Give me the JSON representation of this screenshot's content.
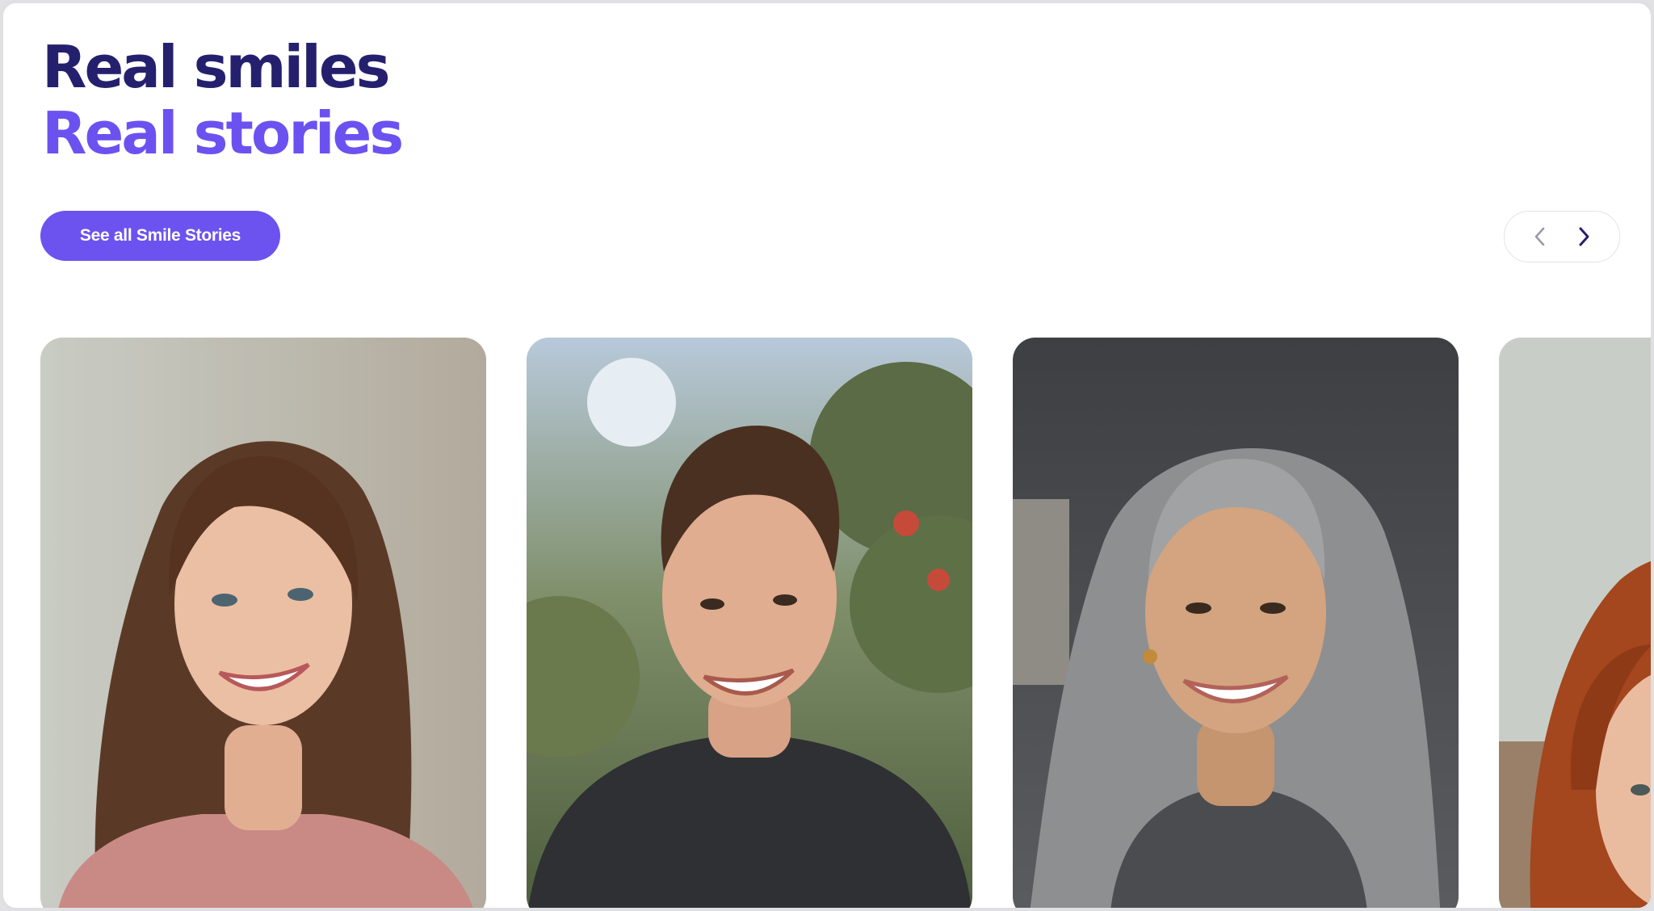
{
  "heading": {
    "line1": "Real smiles",
    "line2": "Real stories"
  },
  "cta": {
    "label": "See all Smile Stories"
  },
  "carousel": {
    "prev_icon": "chevron-left-icon",
    "next_icon": "chevron-right-icon",
    "cards": [
      {
        "photo": "smiling-young-woman-portrait"
      },
      {
        "photo": "smiling-young-man-portrait"
      },
      {
        "photo": "smiling-older-woman-portrait"
      },
      {
        "photo": "smiling-red-haired-woman-portrait"
      }
    ]
  },
  "colors": {
    "heading_dark": "#25206e",
    "heading_accent": "#6b52f0",
    "button": "#6c53ef"
  }
}
